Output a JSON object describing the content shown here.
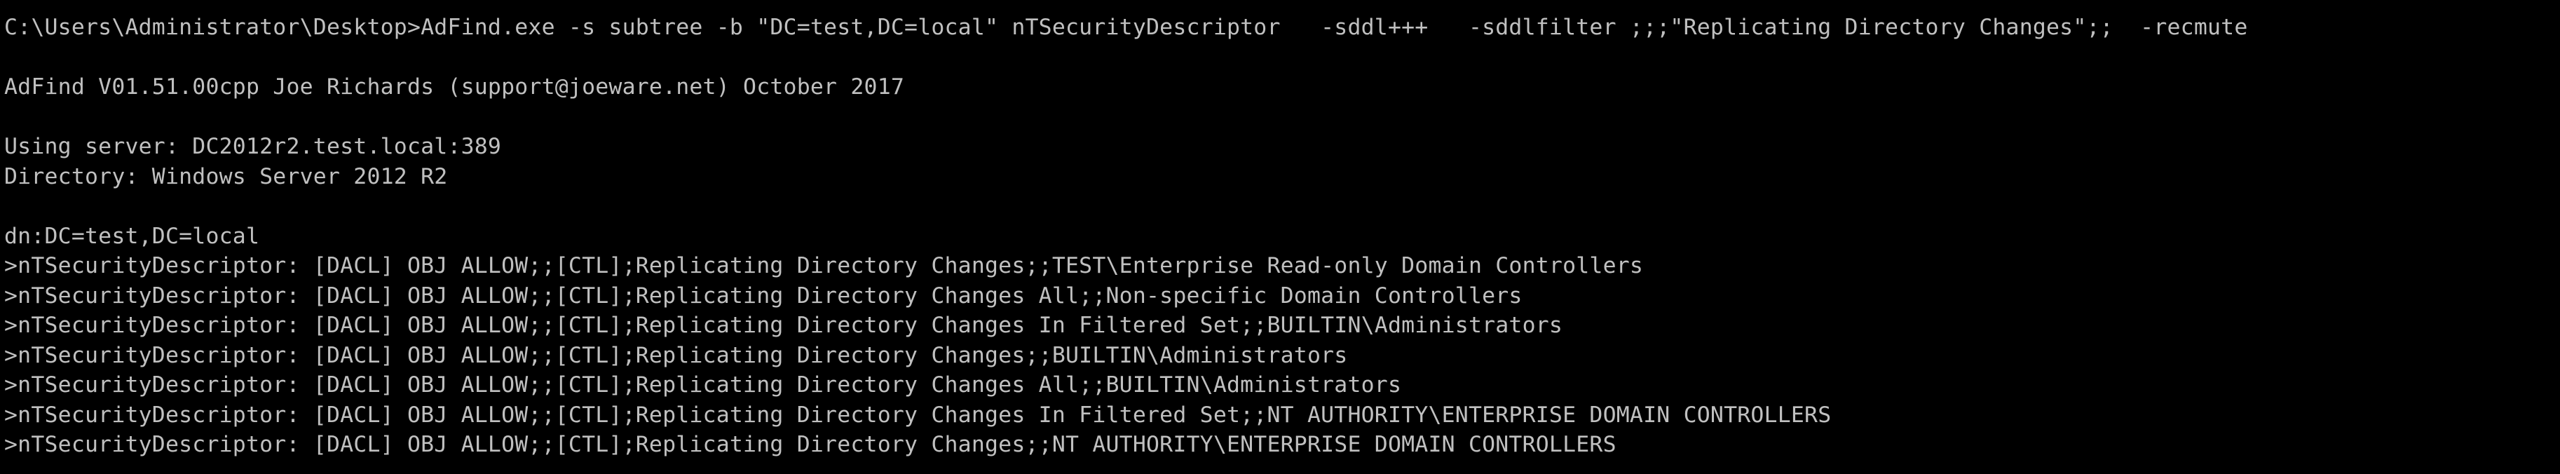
{
  "console": {
    "command_line": "C:\\Users\\Administrator\\Desktop>AdFind.exe -s subtree -b \"DC=test,DC=local\" nTSecurityDescriptor   -sddl+++   -sddlfilter ;;;\"Replicating Directory Changes\";;  -recmute",
    "banner": "AdFind V01.51.00cpp Joe Richards (support@joeware.net) October 2017",
    "server_line": "Using server: DC2012r2.test.local:389",
    "directory_line": "Directory: Windows Server 2012 R2",
    "dn_line": "dn:DC=test,DC=local",
    "results": [
      ">nTSecurityDescriptor: [DACL] OBJ ALLOW;;[CTL];Replicating Directory Changes;;TEST\\Enterprise Read-only Domain Controllers",
      ">nTSecurityDescriptor: [DACL] OBJ ALLOW;;[CTL];Replicating Directory Changes All;;Non-specific Domain Controllers",
      ">nTSecurityDescriptor: [DACL] OBJ ALLOW;;[CTL];Replicating Directory Changes In Filtered Set;;BUILTIN\\Administrators",
      ">nTSecurityDescriptor: [DACL] OBJ ALLOW;;[CTL];Replicating Directory Changes;;BUILTIN\\Administrators",
      ">nTSecurityDescriptor: [DACL] OBJ ALLOW;;[CTL];Replicating Directory Changes All;;BUILTIN\\Administrators",
      ">nTSecurityDescriptor: [DACL] OBJ ALLOW;;[CTL];Replicating Directory Changes In Filtered Set;;NT AUTHORITY\\ENTERPRISE DOMAIN CONTROLLERS",
      ">nTSecurityDescriptor: [DACL] OBJ ALLOW;;[CTL];Replicating Directory Changes;;NT AUTHORITY\\ENTERPRISE DOMAIN CONTROLLERS"
    ]
  },
  "colors": {
    "background": "#000000",
    "text": "#c0c0c0"
  }
}
